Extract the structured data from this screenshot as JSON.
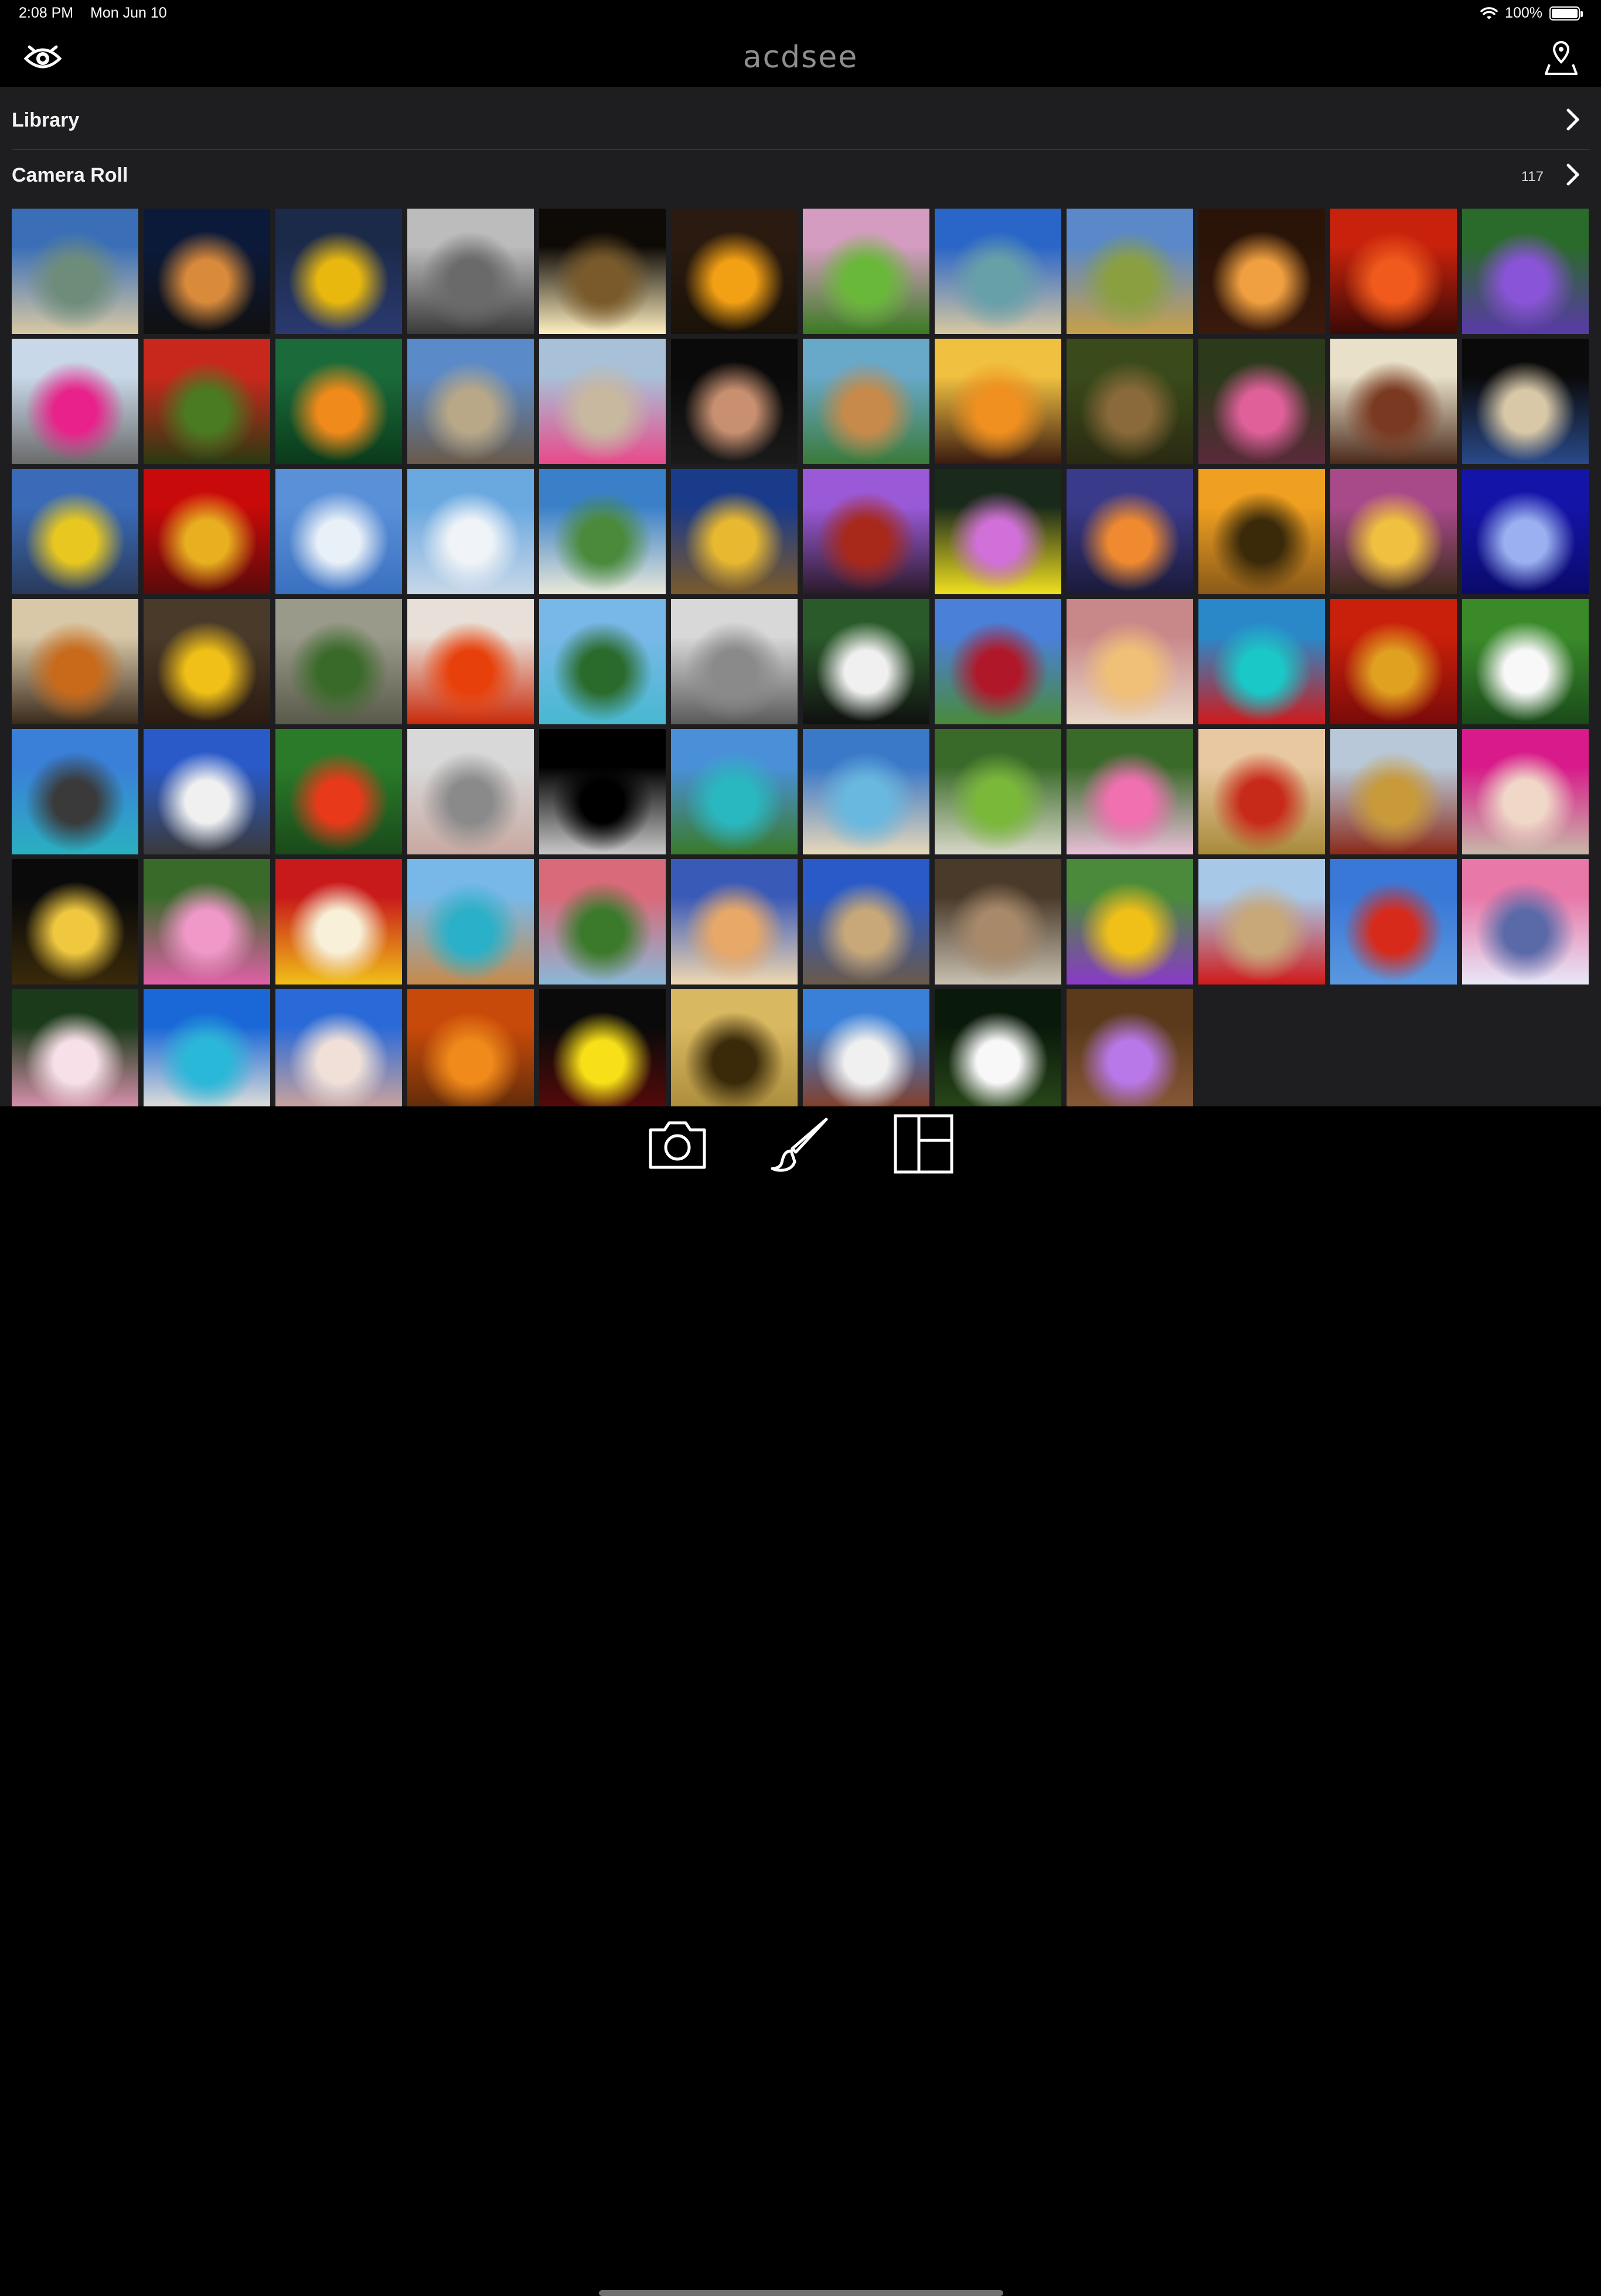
{
  "status_bar": {
    "time": "2:08 PM",
    "date": "Mon Jun 10",
    "battery": "100%",
    "battery_level": 1.0
  },
  "header": {
    "logo_text": "acdsee",
    "left_icon": "acdsee-eye-icon",
    "right_icon": "map-location-icon"
  },
  "library": {
    "label": "Library"
  },
  "camera_roll": {
    "label": "Camera Roll",
    "count": "117"
  },
  "grid": {
    "columns": 12,
    "thumbnails": [
      {
        "name": "beach-cliffs",
        "colors": [
          "#3a6fb8",
          "#6e8c7a",
          "#d9c9a3"
        ]
      },
      {
        "name": "city-night-skyline",
        "colors": [
          "#0c1a3a",
          "#d98a3a",
          "#101010"
        ]
      },
      {
        "name": "yellow-tulips",
        "colors": [
          "#1c2a4a",
          "#e8b80f",
          "#2a3a70"
        ]
      },
      {
        "name": "owl-face",
        "colors": [
          "#bcbcbc",
          "#6a6a6a",
          "#3a3a3a"
        ]
      },
      {
        "name": "light-painting",
        "colors": [
          "#0e0a06",
          "#7a5a2a",
          "#fff0c0"
        ]
      },
      {
        "name": "sunset-horizon",
        "colors": [
          "#2a1a10",
          "#f2a014",
          "#1a1208"
        ]
      },
      {
        "name": "pink-blossom-tree",
        "colors": [
          "#d49cc0",
          "#6ab83a",
          "#3a7a22"
        ]
      },
      {
        "name": "tropical-cove",
        "colors": [
          "#2a66c8",
          "#68a0a8",
          "#d8c8a0"
        ]
      },
      {
        "name": "countryside-path",
        "colors": [
          "#5a88c8",
          "#8aa040",
          "#c8a048"
        ]
      },
      {
        "name": "sky-lantern",
        "colors": [
          "#2a1408",
          "#f0a040",
          "#3a1a0c"
        ]
      },
      {
        "name": "red-sunset-sea",
        "colors": [
          "#c8220c",
          "#f05a1c",
          "#3a0a06"
        ]
      },
      {
        "name": "purple-flowers",
        "colors": [
          "#2a6a2a",
          "#8a54d8",
          "#5a3aa8"
        ]
      },
      {
        "name": "pink-building",
        "colors": [
          "#c8d8e8",
          "#e8228a",
          "#6a6a6a"
        ]
      },
      {
        "name": "moss-statue",
        "colors": [
          "#c8281c",
          "#4a7a22",
          "#2a3a12"
        ]
      },
      {
        "name": "goldfish",
        "colors": [
          "#1a6a3a",
          "#f08a1a",
          "#0a3a1a"
        ]
      },
      {
        "name": "cathedral",
        "colors": [
          "#5a8ac8",
          "#b8a888",
          "#6a5a4a"
        ]
      },
      {
        "name": "palace-garden",
        "colors": [
          "#a8c0d8",
          "#c8b8a0",
          "#e84a8a"
        ]
      },
      {
        "name": "lionfish",
        "colors": [
          "#0a0a0a",
          "#c89070",
          "#1a1a1a"
        ]
      },
      {
        "name": "coastal-village",
        "colors": [
          "#68a8c8",
          "#c88a4a",
          "#3a7a3a"
        ]
      },
      {
        "name": "sunburst-sky",
        "colors": [
          "#f0c040",
          "#f09020",
          "#3a1a10"
        ]
      },
      {
        "name": "hawk",
        "colors": [
          "#3a4a1a",
          "#8a6a3a",
          "#2a2a12"
        ]
      },
      {
        "name": "pink-starfish",
        "colors": [
          "#2a3a1a",
          "#e0609a",
          "#5a2a3a"
        ]
      },
      {
        "name": "korean-palace",
        "colors": [
          "#e8e0c8",
          "#7a3a22",
          "#4a2a1a"
        ]
      },
      {
        "name": "modern-monument",
        "colors": [
          "#0a0a0a",
          "#d8c8a8",
          "#2a4a8a"
        ]
      },
      {
        "name": "golden-tower",
        "colors": [
          "#3a6ab8",
          "#e8c820",
          "#2a3a5a"
        ]
      },
      {
        "name": "golden-statue-red",
        "colors": [
          "#c80a0a",
          "#e8b020",
          "#5a0a0a"
        ]
      },
      {
        "name": "bird-in-sky",
        "colors": [
          "#5a90d8",
          "#e8f0f8",
          "#3a70c0"
        ]
      },
      {
        "name": "white-beach",
        "colors": [
          "#6aa8e0",
          "#f0f4f8",
          "#c8d8e8"
        ]
      },
      {
        "name": "island-coast",
        "colors": [
          "#3a80c8",
          "#4a8a3a",
          "#e8e8d8"
        ]
      },
      {
        "name": "golden-stupa",
        "colors": [
          "#1a3a8a",
          "#e8b830",
          "#7a5a2a"
        ]
      },
      {
        "name": "pagoda",
        "colors": [
          "#9a5ad8",
          "#a8281a",
          "#2a1a2a"
        ]
      },
      {
        "name": "pink-aster",
        "colors": [
          "#1a2a1a",
          "#d070d8",
          "#f0e020"
        ]
      },
      {
        "name": "colorful-dusk",
        "colors": [
          "#3a3a8a",
          "#f08a30",
          "#1a1a3a"
        ]
      },
      {
        "name": "jungle-sunset",
        "colors": [
          "#f0a020",
          "#3a2a0a",
          "#8a5a1a"
        ]
      },
      {
        "name": "tree-sunset",
        "colors": [
          "#a84a8a",
          "#f0c040",
          "#3a2a1a"
        ]
      },
      {
        "name": "jellyfish",
        "colors": [
          "#1414a8",
          "#9ab0f0",
          "#0a0a6a"
        ]
      },
      {
        "name": "thai-temple",
        "colors": [
          "#d8c8a8",
          "#c86a1a",
          "#3a2a1a"
        ]
      },
      {
        "name": "maple-leaf",
        "colors": [
          "#4a3a2a",
          "#f0c018",
          "#2a1a10"
        ]
      },
      {
        "name": "karst-mountains",
        "colors": [
          "#9a9a8a",
          "#3a6a2a",
          "#5a5a4a"
        ]
      },
      {
        "name": "strawberry-bowl",
        "colors": [
          "#e8e0d8",
          "#e8400a",
          "#c82a0a"
        ]
      },
      {
        "name": "alpine-lake",
        "colors": [
          "#78b8e8",
          "#2a6a2a",
          "#48b8d0"
        ]
      },
      {
        "name": "monkeys",
        "colors": [
          "#d8d8d8",
          "#8a8a8a",
          "#5a5a5a"
        ]
      },
      {
        "name": "panda",
        "colors": [
          "#2a5a2a",
          "#f0f0f0",
          "#101010"
        ]
      },
      {
        "name": "red-tree",
        "colors": [
          "#4a80d8",
          "#b0182a",
          "#4a8a3a"
        ]
      },
      {
        "name": "warm-figure",
        "colors": [
          "#c8888a",
          "#f0c078",
          "#e8d8c8"
        ]
      },
      {
        "name": "turquoise-lake-canoes",
        "colors": [
          "#2a88c8",
          "#1ac8c8",
          "#d01a1a"
        ]
      },
      {
        "name": "red-mask",
        "colors": [
          "#c8200a",
          "#e0a020",
          "#7a0a0a"
        ]
      },
      {
        "name": "white-flower-leaves",
        "colors": [
          "#3a8a2a",
          "#f8f8f8",
          "#1a4a1a"
        ]
      },
      {
        "name": "limestone-cove",
        "colors": [
          "#3a80d8",
          "#3a3a3a",
          "#2ab0c0"
        ]
      },
      {
        "name": "white-church",
        "colors": [
          "#2a5ac8",
          "#f0f0f0",
          "#3a3a3a"
        ]
      },
      {
        "name": "red-bloom",
        "colors": [
          "#2a7a2a",
          "#e83a1a",
          "#1a4a1a"
        ]
      },
      {
        "name": "persian-cat",
        "colors": [
          "#d8d8d8",
          "#8a8a8a",
          "#c8a8a0"
        ]
      },
      {
        "name": "full-moon",
        "colors": [
          "#000000",
          "#000000",
          "#c8c8c8"
        ]
      },
      {
        "name": "turquoise-bay",
        "colors": [
          "#4a90d8",
          "#2ab8c0",
          "#3a7a2a"
        ]
      },
      {
        "name": "calm-beach",
        "colors": [
          "#3a78c8",
          "#68b8e0",
          "#e8d8b8"
        ]
      },
      {
        "name": "boardwalk-meadow",
        "colors": [
          "#3a6a2a",
          "#7ab83a",
          "#d8d8c8"
        ]
      },
      {
        "name": "pink-flower-cluster",
        "colors": [
          "#3a6a2a",
          "#f070b0",
          "#e8c0d8"
        ]
      },
      {
        "name": "ornate-tower",
        "colors": [
          "#e8c8a0",
          "#c82a1a",
          "#a88a3a"
        ]
      },
      {
        "name": "chinese-temple",
        "colors": [
          "#b8c8d8",
          "#c89a3a",
          "#8a2a1a"
        ]
      },
      {
        "name": "magenta-petals",
        "colors": [
          "#d81a8a",
          "#f0d8c8",
          "#c8b8a8"
        ]
      },
      {
        "name": "fountain-night",
        "colors": [
          "#0a0a0a",
          "#f0c840",
          "#3a2a0a"
        ]
      },
      {
        "name": "pink-hibiscus",
        "colors": [
          "#3a6a2a",
          "#f098c8",
          "#e060a8"
        ]
      },
      {
        "name": "frangipani-fruit",
        "colors": [
          "#c81a1a",
          "#f8f0d8",
          "#f0c018"
        ]
      },
      {
        "name": "longtail-boat",
        "colors": [
          "#78b8e8",
          "#2ab0c8",
          "#c88a4a"
        ]
      },
      {
        "name": "mountain-stream",
        "colors": [
          "#d86a7a",
          "#3a7a2a",
          "#8ab8d8"
        ]
      },
      {
        "name": "golden-gateway",
        "colors": [
          "#3a5ab8",
          "#e8a868",
          "#f0d8b0"
        ]
      },
      {
        "name": "historic-building",
        "colors": [
          "#2a5ac8",
          "#c8a878",
          "#6a5a4a"
        ]
      },
      {
        "name": "bronze-statue",
        "colors": [
          "#4a3a2a",
          "#a88a6a",
          "#c8c0b0"
        ]
      },
      {
        "name": "colorful-kayaks",
        "colors": [
          "#4a8a3a",
          "#f0c018",
          "#8a3ac8"
        ]
      },
      {
        "name": "big-ben-bus",
        "colors": [
          "#a8c8e8",
          "#c8a878",
          "#d01a1a"
        ]
      },
      {
        "name": "red-sculpture",
        "colors": [
          "#3a78d8",
          "#d82a1a",
          "#5a98e0"
        ]
      },
      {
        "name": "winter-cabin",
        "colors": [
          "#e878a8",
          "#5a6aa8",
          "#e8e8f8"
        ]
      },
      {
        "name": "white-lily",
        "colors": [
          "#1a3a1a",
          "#f8e0e8",
          "#e898b8"
        ]
      },
      {
        "name": "tropical-beach",
        "colors": [
          "#1a68d8",
          "#2ab8d8",
          "#f0e8d8"
        ]
      },
      {
        "name": "white-gazebo",
        "colors": [
          "#2a6ad8",
          "#f0e0d8",
          "#d8a898"
        ]
      },
      {
        "name": "autumn-forest",
        "colors": [
          "#c84a0a",
          "#f08a1a",
          "#5a2a0a"
        ]
      },
      {
        "name": "yellow-marigold",
        "colors": [
          "#0a0a0a",
          "#f8e018",
          "#5a0a0a"
        ]
      },
      {
        "name": "carved-figure",
        "colors": [
          "#d8b860",
          "#3a2a0a",
          "#a88a3a"
        ]
      },
      {
        "name": "thai-palace-spires",
        "colors": [
          "#3a80d8",
          "#f0f0f0",
          "#8a3a1a"
        ]
      },
      {
        "name": "white-waterlily",
        "colors": [
          "#0a1a0a",
          "#f8f8f8",
          "#2a4a1a"
        ]
      },
      {
        "name": "purple-flower-bowl",
        "colors": [
          "#5a3a1a",
          "#b878e8",
          "#8a5a3a"
        ]
      }
    ]
  },
  "tab_bar": {
    "items": [
      {
        "name": "camera-icon"
      },
      {
        "name": "edit-brush-icon"
      },
      {
        "name": "layout-grid-icon"
      }
    ]
  }
}
